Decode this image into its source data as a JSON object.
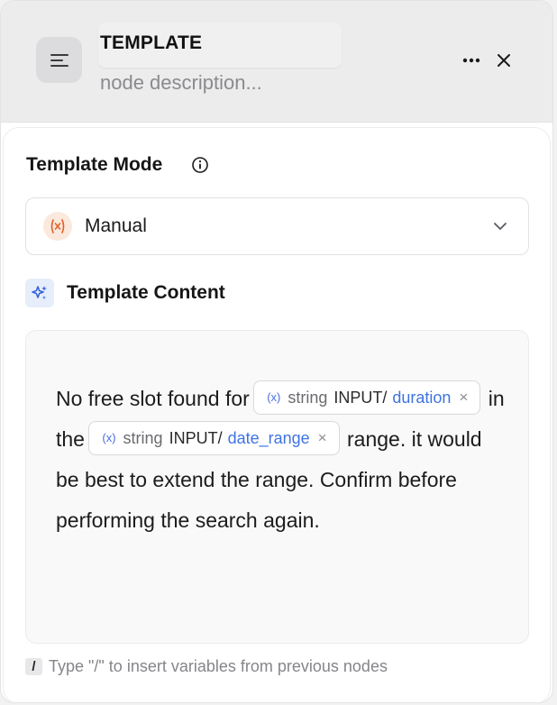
{
  "header": {
    "title": "TEMPLATE",
    "description_placeholder": "node description...",
    "icons": {
      "node": "list-lines-icon",
      "more": "more-horizontal-icon",
      "close": "close-icon"
    }
  },
  "template_mode": {
    "label": "Template Mode",
    "info_icon": "info-icon",
    "selected_value": "Manual",
    "value_icon": "variable-icon",
    "chevron_icon": "chevron-down-icon"
  },
  "template_content": {
    "label": "Template Content",
    "label_icon": "sparkle-icon",
    "text": {
      "part1": "No free slot found for",
      "part2": "in the",
      "part3": "range. it would be best to extend the range. Confirm before performing the search again."
    },
    "chips": [
      {
        "glyph": "(x)",
        "type": "string",
        "source": "INPUT/",
        "name": "duration",
        "remove": "×"
      },
      {
        "glyph": "(x)",
        "type": "string",
        "source": "INPUT/",
        "name": "date_range",
        "remove": "×"
      }
    ]
  },
  "hint": {
    "key": "/",
    "text": "Type \"/\" to insert variables from previous nodes"
  },
  "colors": {
    "accent_blue": "#3f73e0",
    "accent_orange": "#e0602a",
    "header_bg": "#ececed"
  }
}
